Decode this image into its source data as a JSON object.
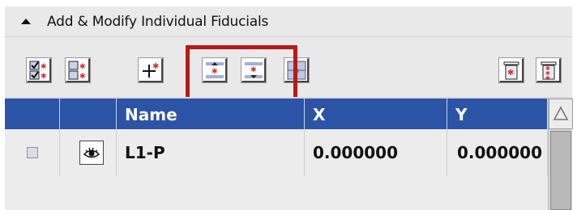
{
  "panel": {
    "title": "Add & Modify Individual Fiducials"
  },
  "toolbar": {
    "buttons": [
      {
        "name": "select-all-fiducials-button",
        "icon": "checked-list-icon"
      },
      {
        "name": "deselect-all-fiducials-button",
        "icon": "unchecked-list-icon"
      },
      {
        "name": "add-fiducial-button",
        "icon": "add-fiducial-icon"
      },
      {
        "name": "move-fiducial-up-button",
        "icon": "move-up-icon"
      },
      {
        "name": "move-fiducial-down-button",
        "icon": "move-down-icon"
      },
      {
        "name": "fiducial-grid-button",
        "icon": "fiducial-grid-icon"
      },
      {
        "name": "delete-fiducial-button",
        "icon": "trash-icon"
      },
      {
        "name": "delete-all-fiducials-button",
        "icon": "trash-all-icon"
      }
    ],
    "highlight_color": "#b81818"
  },
  "table": {
    "columns": [
      "",
      "",
      "Name",
      "X",
      "Y"
    ],
    "rows": [
      {
        "selected": false,
        "visible_icon": "eye-icon",
        "name": "L1-P",
        "x": "0.000000",
        "y": "0.000000"
      }
    ],
    "header_color": "#2c54a6"
  }
}
